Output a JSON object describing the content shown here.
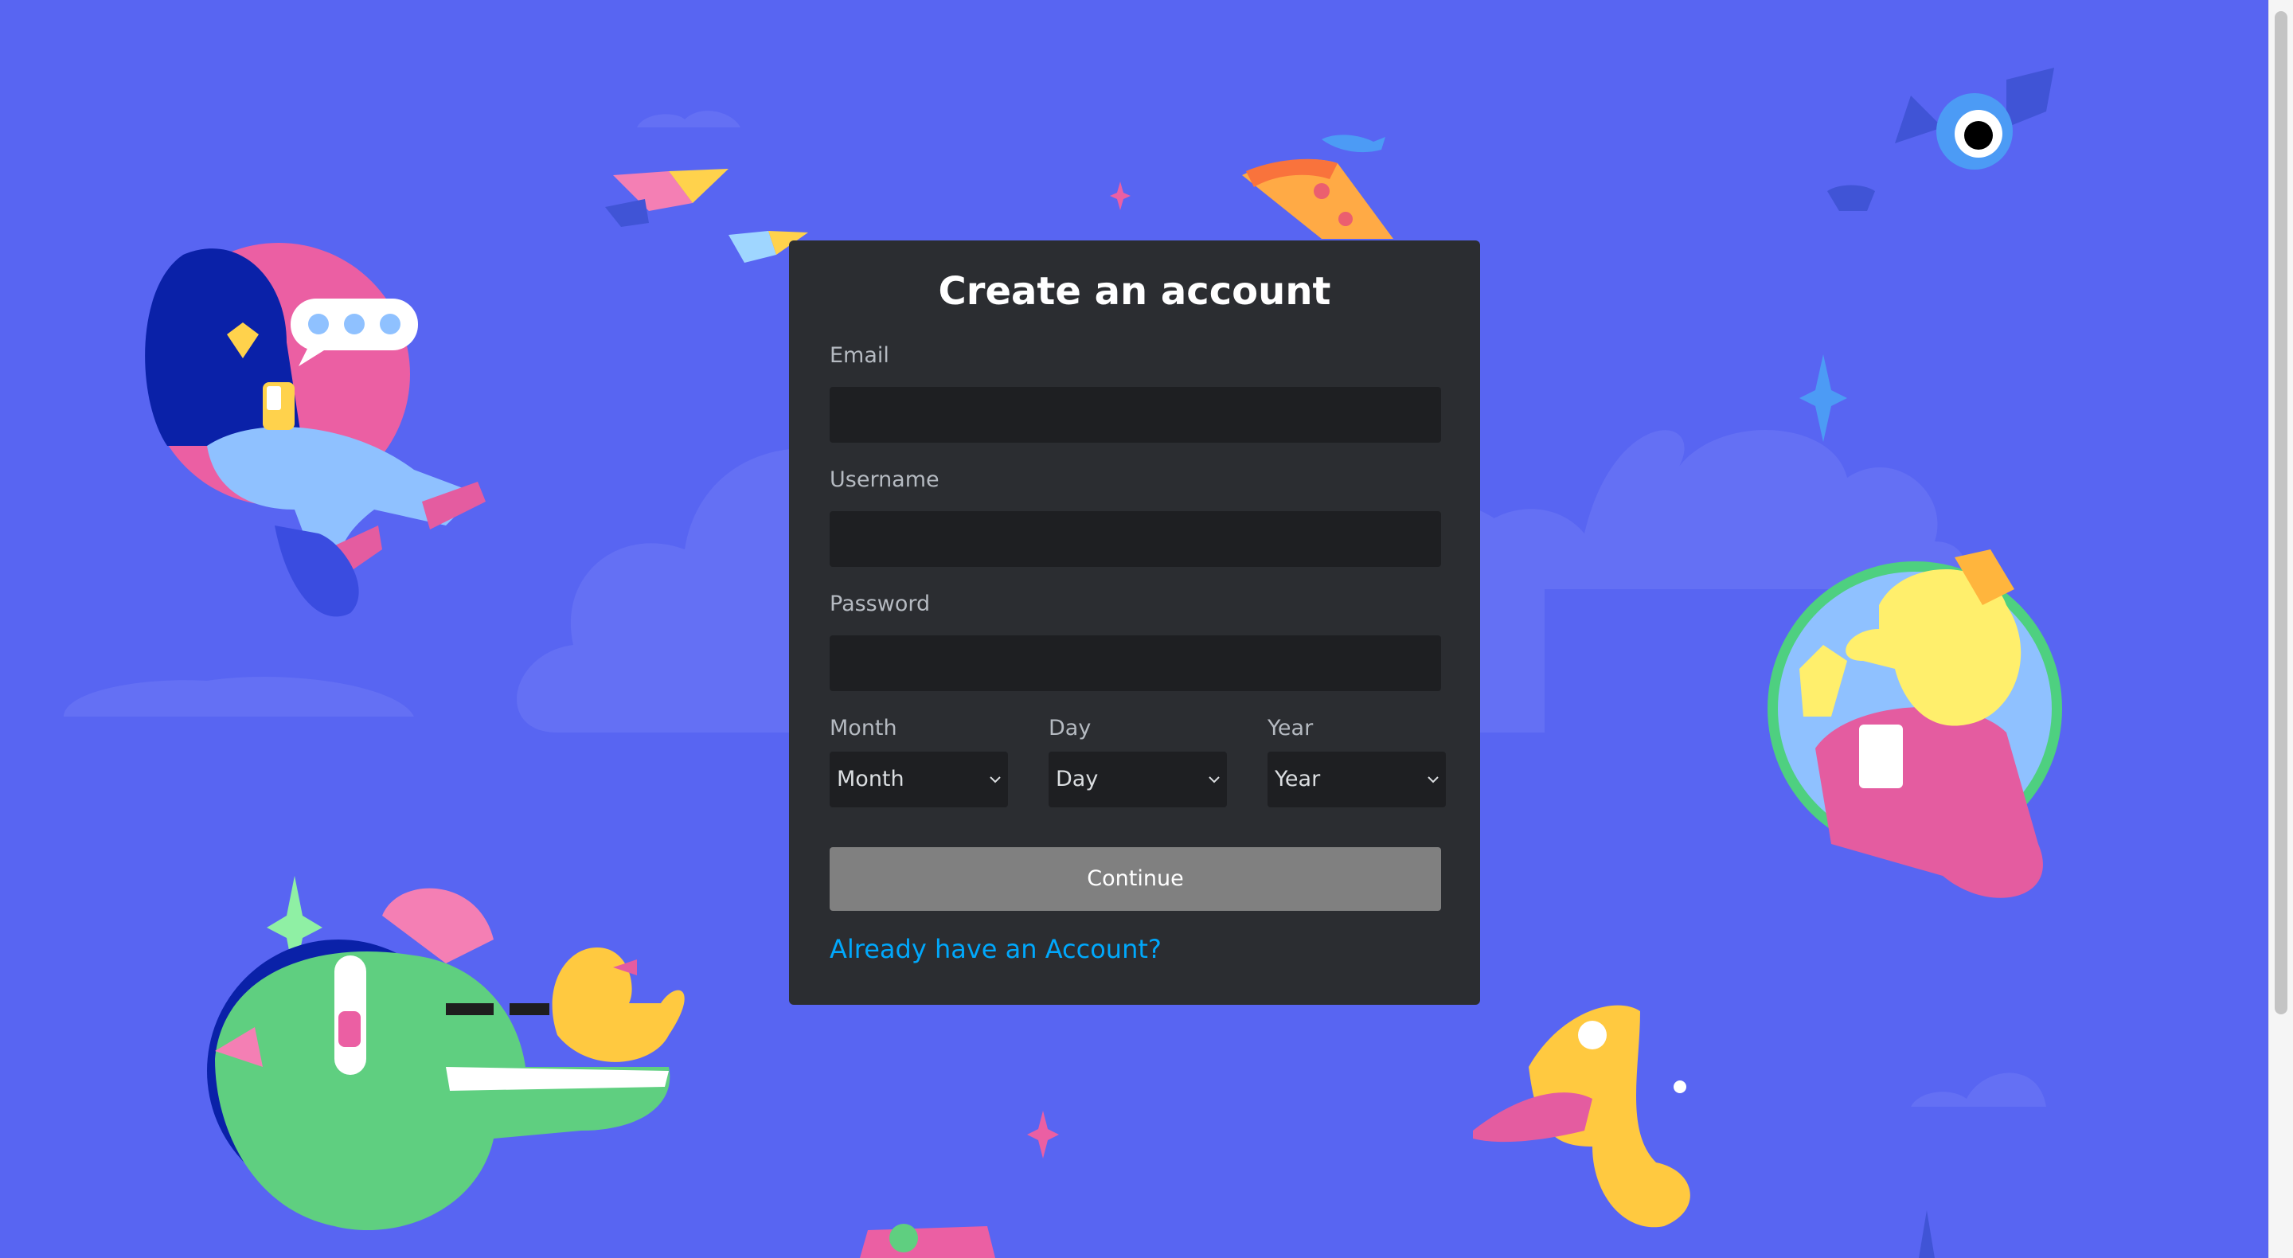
{
  "colors": {
    "background": "#5865f2",
    "card": "#2b2d31",
    "input": "#1e1f22",
    "button": "#808080",
    "link": "#00a8fc"
  },
  "form": {
    "title": "Create an account",
    "email_label": "Email",
    "email_value": "",
    "username_label": "Username",
    "username_value": "",
    "password_label": "Password",
    "password_value": "",
    "month_label": "Month",
    "month_value": "Month",
    "day_label": "Day",
    "day_value": "Day",
    "year_label": "Year",
    "year_value": "Year",
    "continue_label": "Continue",
    "login_link": "Already have an Account?"
  },
  "illustrations": [
    "girl-with-phone",
    "speech-bubble",
    "flying-books",
    "pizza-slice",
    "fish",
    "bat-creature",
    "sparkle",
    "waving-character",
    "crocodile-with-headphones",
    "duck",
    "trumpet-creature",
    "robot-toy",
    "clouds"
  ]
}
